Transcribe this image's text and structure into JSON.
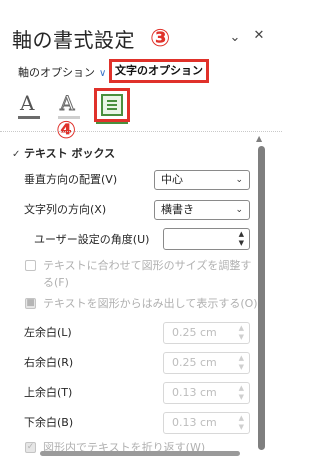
{
  "panel": {
    "title": "軸の書式設定",
    "controls": {
      "dropdown_icon": "chevron-down-icon",
      "close_icon": "close-icon"
    }
  },
  "annotations": {
    "badge3": "③",
    "badge4": "④",
    "highlight_color": "#e0312a"
  },
  "tabs": {
    "shape_options": "軸のオプション",
    "text_options": "文字のオプション"
  },
  "icon_tabs": [
    {
      "name": "text-fill-icon",
      "glyph": "A"
    },
    {
      "name": "text-outline-icon",
      "glyph": "A"
    },
    {
      "name": "textbox-icon",
      "selected": true
    }
  ],
  "section": {
    "title": "テキスト ボックス"
  },
  "fields": {
    "vertical_align": {
      "label": "垂直方向の配置(V)",
      "value": "中心"
    },
    "text_direction": {
      "label": "文字列の方向(X)",
      "value": "横書き"
    },
    "custom_angle": {
      "label": "ユーザー設定の角度(U)",
      "value": ""
    },
    "autofit_resize": {
      "label": "テキストに合わせて図形のサイズを調整する(F)"
    },
    "allow_overflow": {
      "label": "テキストを図形からはみ出して表示する(O)"
    },
    "left_margin": {
      "label": "左余白(L)",
      "value": "0.25 cm"
    },
    "right_margin": {
      "label": "右余白(R)",
      "value": "0.25 cm"
    },
    "top_margin": {
      "label": "上余白(T)",
      "value": "0.13 cm"
    },
    "bottom_margin": {
      "label": "下余白(B)",
      "value": "0.13 cm"
    },
    "wrap_text": {
      "label": "図形内でテキストを折り返す(W)"
    }
  },
  "colors": {
    "accent_green": "#4a8f3d",
    "link_blue": "#3a73c7",
    "disabled_text": "#b0b0b0"
  }
}
